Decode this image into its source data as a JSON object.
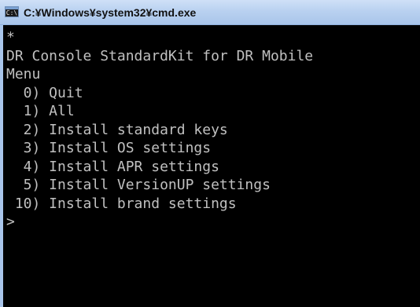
{
  "window": {
    "title": "C:¥Windows¥system32¥cmd.exe",
    "icon_name": "cmd-app-icon",
    "icon_glyph": "C:\\"
  },
  "console": {
    "lines": [
      "*",
      "DR Console StandardKit for DR Mobile",
      "Menu",
      "  0) Quit",
      "  1) All",
      "  2) Install standard keys",
      "  3) Install OS settings",
      "  4) Install APR settings",
      "  5) Install VersionUP settings",
      " 10) Install brand settings",
      ">"
    ],
    "colors": {
      "background": "#000000",
      "text": "#c0c0c0"
    }
  }
}
